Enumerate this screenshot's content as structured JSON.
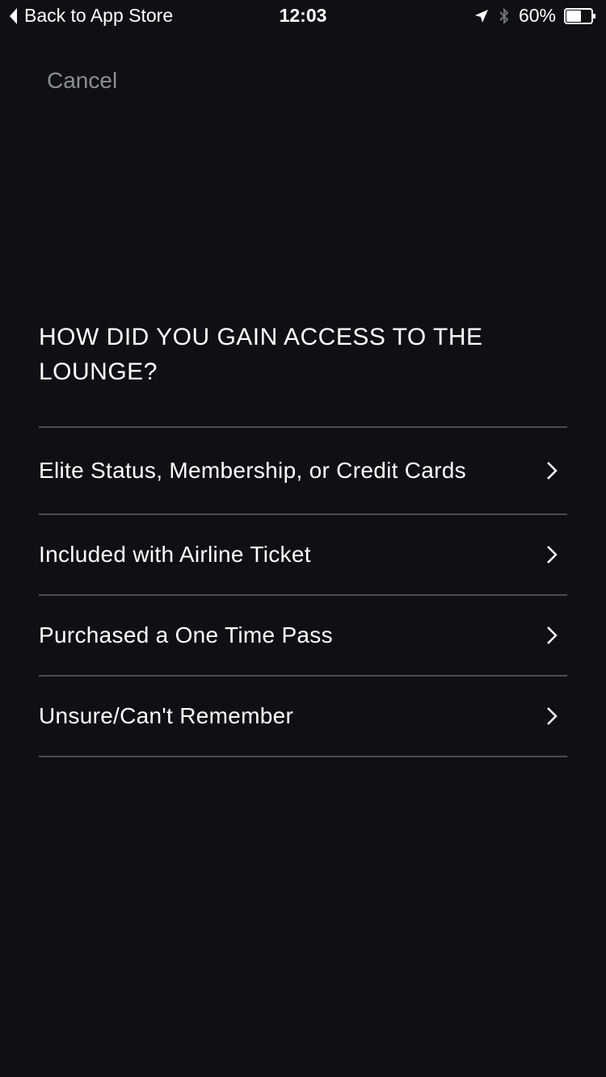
{
  "status_bar": {
    "back_label": "Back to App Store",
    "time": "12:03",
    "battery": "60%",
    "battery_level": 0.6,
    "icons": [
      "back-chevron-icon",
      "location-arrow-icon",
      "bluetooth-icon",
      "battery-icon"
    ]
  },
  "nav": {
    "cancel_label": "Cancel"
  },
  "question": {
    "text": "HOW DID YOU GAIN ACCESS TO THE LOUNGE?"
  },
  "options": [
    {
      "label": "Elite Status, Membership, or Credit Cards"
    },
    {
      "label": "Included with Airline Ticket"
    },
    {
      "label": "Purchased a One Time Pass"
    },
    {
      "label": "Unsure/Can't Remember"
    }
  ],
  "colors": {
    "background": "#0e1014",
    "text": "#ffffff",
    "muted": "#8a8d92",
    "divider": "#4a4c50"
  }
}
